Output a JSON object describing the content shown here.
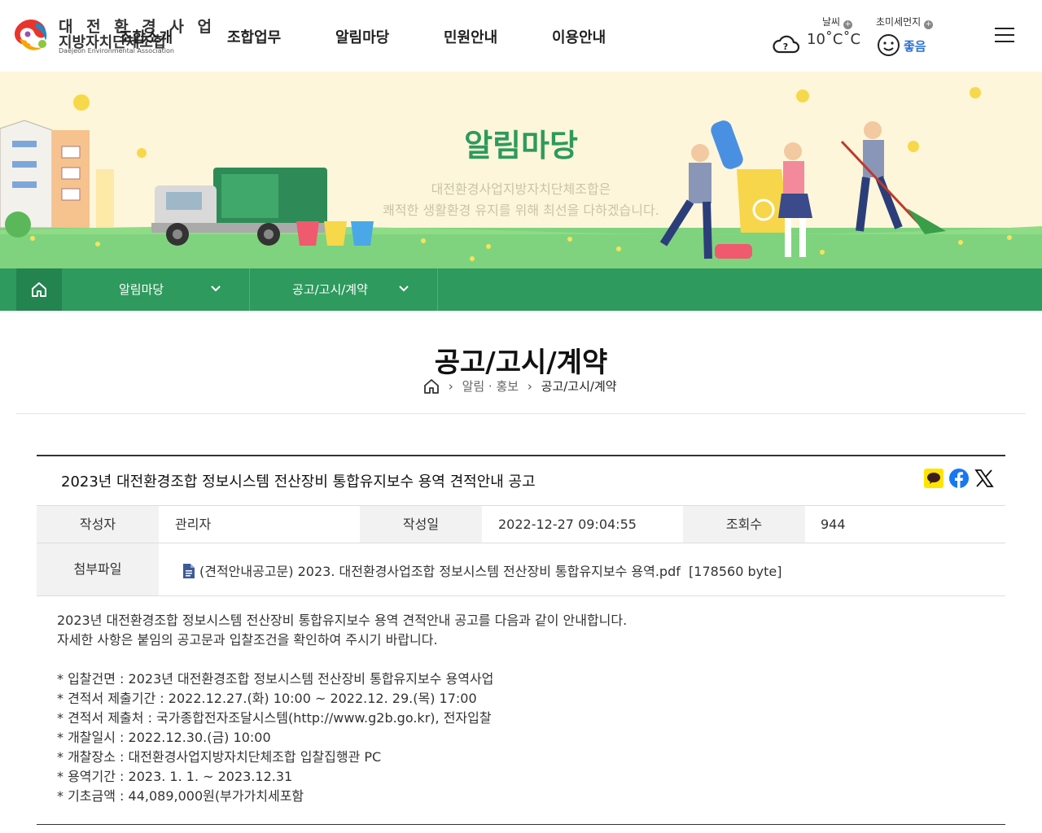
{
  "header": {
    "logo": {
      "line1": "대 전 환 경 사 업",
      "line2": "지방자치단체조합",
      "line3": "Daejeon Environmental Association"
    },
    "nav": [
      "조합소개",
      "조합업무",
      "알림마당",
      "민원안내",
      "이용안내"
    ],
    "weather": {
      "label": "날씨",
      "value": "10˚C˚C",
      "icon": "cloud-question-icon"
    },
    "dust": {
      "label": "초미세먼지",
      "value": "좋음",
      "icon": "smile-face-icon"
    }
  },
  "banner": {
    "title": "알림마당",
    "subtitle_line1": "대전환경사업지방자치단체조합은",
    "subtitle_line2": "쾌적한 생활환경 유지를 위해 최선을 다하겠습니다."
  },
  "subnav": {
    "menu1": "알림마당",
    "menu2": "공고/고시/계약"
  },
  "page": {
    "title": "공고/고시/계약",
    "breadcrumb": [
      "알림 · 홍보",
      "공고/고시/계약"
    ]
  },
  "article": {
    "title": "2023년 대전환경조합 정보시스템 전산장비 통합유지보수 용역 견적안내 공고",
    "share": [
      "kakaotalk-icon",
      "facebook-icon",
      "x-icon"
    ],
    "author_label": "작성자",
    "author": "관리자",
    "date_label": "작성일",
    "date": "2022-12-27 09:04:55",
    "views_label": "조회수",
    "views": "944",
    "file_label": "첨부파일",
    "file": "(견적안내공고문) 2023. 대전환경사업조합 정보시스템 전산장비 통합유지보수 용역.pdf  [178560 byte]",
    "body": {
      "intro1": "2023년 대전환경조합 정보시스템 전산장비 통합유지보수 용역 견적안내 공고를 다음과 같이 안내합니다.",
      "intro2": "자세한 사항은 붙임의 공고문과 입찰조건을 확인하여 주시기 바랍니다.",
      "items": [
        "* 입찰건면 : 2023년 대전환경조합 정보시스템 전산장비 통합유지보수 용역사업",
        "* 견적서 제출기간 : 2022.12.27.(화) 10:00 ~ 2022.12. 29.(목) 17:00",
        "* 견적서 제출처 : 국가종합전자조달시스템(http://www.g2b.go.kr), 전자입찰",
        "* 개찰일시 : 2022.12.30.(금) 10:00",
        "* 개찰장소 : 대전환경사업지방자치단체조합 입찰집행관 PC",
        "* 용역기간 : 2023. 1. 1. ~ 2023.12.31",
        "* 기초금액 : 44,089,000원(부가가치세포함"
      ]
    }
  },
  "colors": {
    "brand_green": "#2e9a5e",
    "home_green": "#238450",
    "banner_bg": "#fdf6da",
    "grass": "#7fd37e",
    "dust_blue": "#2a6fd6"
  }
}
